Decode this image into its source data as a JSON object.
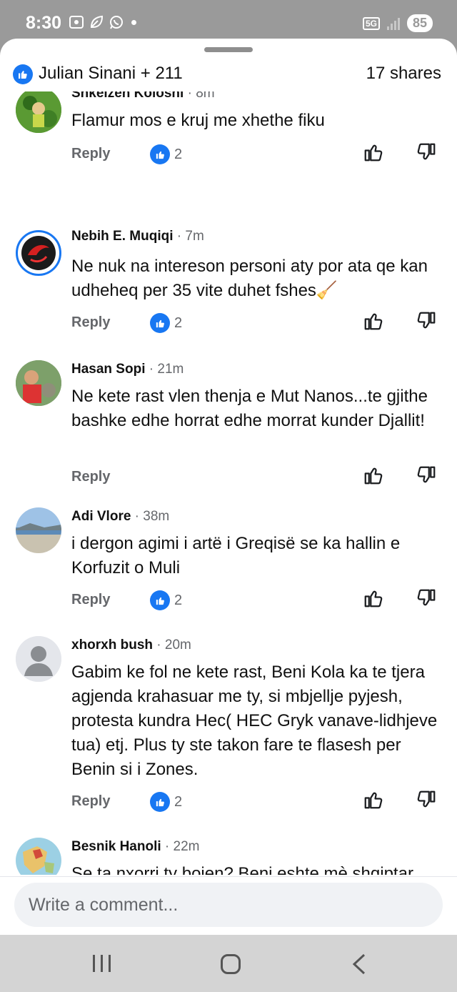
{
  "status_bar": {
    "time": "8:30",
    "network": "5G",
    "battery": "85"
  },
  "header": {
    "reactors": "Julian Sinani + 211",
    "shares": "17 shares"
  },
  "comments": [
    {
      "author": "Shkelzen Kolosni",
      "time": "8m",
      "text": "Flamur mos e kruj me xhethe fiku",
      "reply_label": "Reply",
      "likes": "2"
    },
    {
      "author": "Nebih E. Muqiqi",
      "time": "7m",
      "text": "Ne nuk na intereson personi aty por ata qe kan udheheq per 35 vite duhet fshes🧹",
      "reply_label": "Reply",
      "likes": "2"
    },
    {
      "author": "Hasan Sopi",
      "time": "21m",
      "text": "Ne kete rast vlen thenja e Mut Nanos...te gjithe bashke edhe horrat edhe morrat kunder Djallit!",
      "reply_label": "Reply",
      "likes": ""
    },
    {
      "author": "Adi Vlore",
      "time": "38m",
      "text": "i dergon agimi i artë i Greqisë se ka hallin e Korfuzit o Muli",
      "reply_label": "Reply",
      "likes": "2"
    },
    {
      "author": "xhorxh bush",
      "time": "20m",
      "text": "Gabim ke fol ne kete rast, Beni Kola ka te tjera agjenda krahasuar me ty,  si mbjellje pyjesh, protesta kundra Hec( HEC Gryk vanave-lidhjeve tua) etj. Plus ty ste takon fare te flasesh per Benin si i Zones.",
      "reply_label": "Reply",
      "likes": "2"
    },
    {
      "author": "Besnik Hanoli",
      "time": "22m",
      "text": "Se ta nxorri ty bojen? Beni eshte mè shqiptar nga te gjithe  ,keshtu qe  ikni ikni",
      "reply_label": "",
      "likes": ""
    }
  ],
  "composer": {
    "placeholder": "Write a comment..."
  },
  "colors": {
    "facebook_blue": "#1877f2",
    "secondary_text": "#65676b",
    "status_gray": "#9a9a9a"
  },
  "icons": {
    "like_badge": "thumbs-up-icon",
    "thumb_up": "thumb-up-outline-icon",
    "thumb_down": "thumb-down-outline-icon"
  }
}
